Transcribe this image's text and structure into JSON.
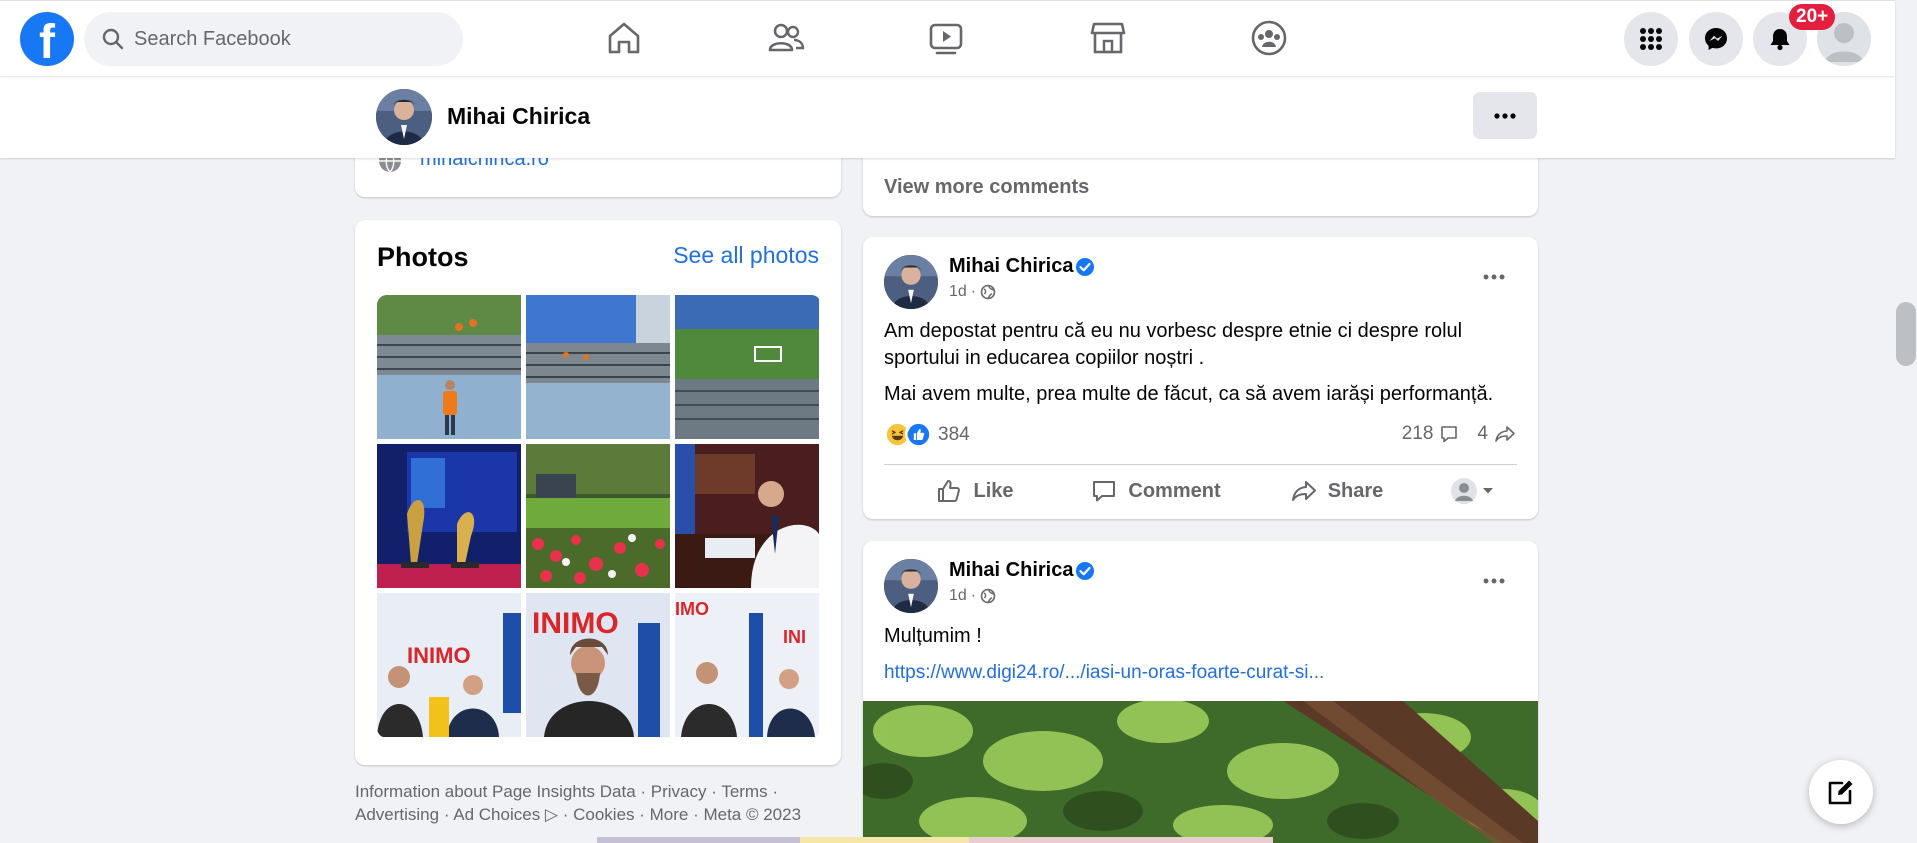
{
  "topbar": {
    "logo": "f",
    "search_placeholder": "Search Facebook",
    "nav_icons": [
      "home-icon",
      "friends-icon",
      "watch-icon",
      "marketplace-icon",
      "groups-icon"
    ],
    "right_icons": [
      "menu-grid-icon",
      "messenger-icon",
      "bell-icon"
    ],
    "notifications_badge": "20+"
  },
  "page_header": {
    "name": "Mihai Chirica",
    "more_label": "···"
  },
  "intro": {
    "website": "mihaichirica.ro"
  },
  "photos": {
    "title": "Photos",
    "see_all": "See all photos"
  },
  "footer": {
    "text": "Information about Page Insights Data · Privacy · Terms · Advertising · Ad Choices ▷ · Cookies · More · Meta © 2023"
  },
  "comments": {
    "view_more": "View more comments"
  },
  "posts": [
    {
      "author": "Mihai Chirica",
      "time": "1d",
      "paragraphs": [
        "Am depostat pentru că eu nu vorbesc despre etnie ci despre rolul sportului in educarea copiilor noștri .",
        "Mai avem multe, prea multe de făcut,  ca să avem iarăși performanță."
      ],
      "reactions_count": "384",
      "comments_count": "218",
      "shares_count": "4",
      "actions": {
        "like": "Like",
        "comment": "Comment",
        "share": "Share"
      }
    },
    {
      "author": "Mihai Chirica",
      "time": "1d",
      "text": "Mulțumim !",
      "link": "https://www.digi24.ro/.../iasi-un-oras-foarte-curat-si..."
    }
  ],
  "colors": {
    "brand": "#1877f2",
    "link": "#216fdb",
    "badge": "#e41e3f",
    "background": "#f0f2f5"
  }
}
